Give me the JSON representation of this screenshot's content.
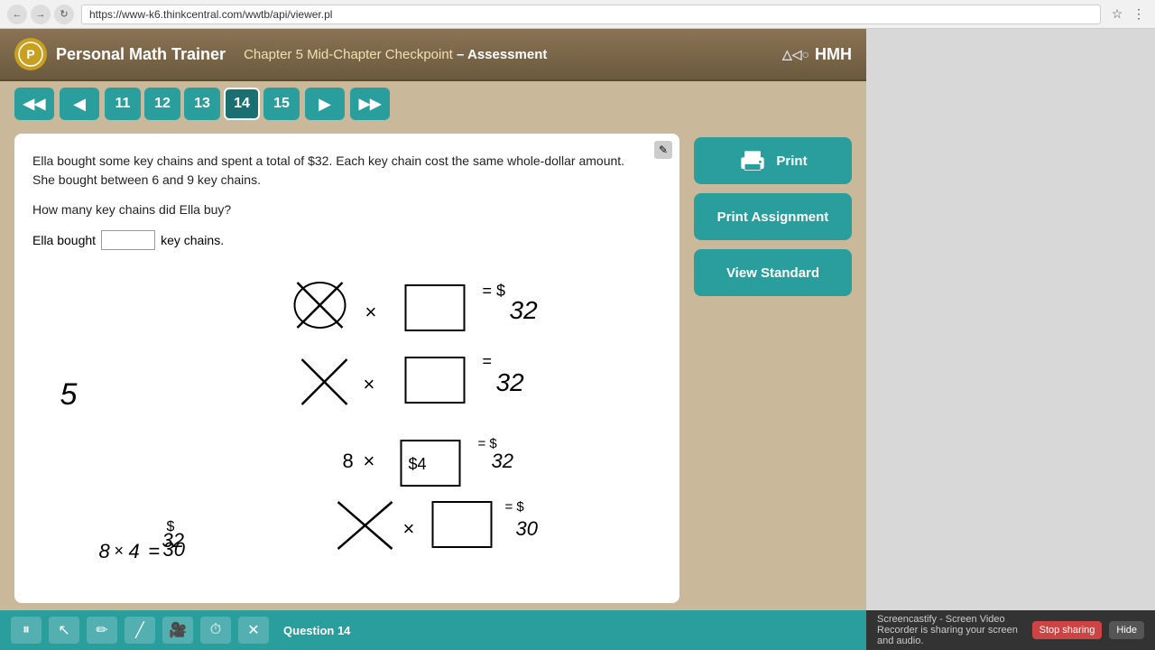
{
  "browser": {
    "url": "https://www-k6.thinkcentral.com/wwtb/api/viewer.pl",
    "back_label": "←",
    "forward_label": "→",
    "refresh_label": "↻"
  },
  "header": {
    "app_title": "Personal Math Trainer",
    "chapter_label": "Chapter 5 Mid-Chapter Checkpoint",
    "assessment_label": "– Assessment",
    "hmh_label": "HMH"
  },
  "navigation": {
    "skip_back_label": "◀◀",
    "prev_label": "◀",
    "next_label": "▶",
    "skip_next_label": "▶▶",
    "pages": [
      "11",
      "12",
      "13",
      "14",
      "15"
    ],
    "active_page": "14"
  },
  "question": {
    "text_line1": "Ella bought some key chains and spent a total of $32. Each key chain cost the same whole-dollar amount.",
    "text_line2": "She bought between 6 and 9 key chains.",
    "question_text": "How many key chains did Ella buy?",
    "answer_prefix": "Ella bought",
    "answer_suffix": "key chains.",
    "answer_placeholder": ""
  },
  "sidebar": {
    "print_label": "Print",
    "print_assignment_label": "Print Assignment",
    "view_standard_label": "View Standard"
  },
  "bottom_toolbar": {
    "pause_label": "⏸",
    "cursor_label": "↖",
    "pen_label": "✏",
    "line_label": "╱",
    "video_label": "🎥",
    "timer_label": "⏱",
    "close_label": "✕",
    "question_label": "estion 14"
  },
  "screencastify": {
    "message": "Screencastify - Screen Video Recorder is sharing your screen and audio.",
    "stop_label": "Stop sharing",
    "hide_label": "Hide"
  }
}
